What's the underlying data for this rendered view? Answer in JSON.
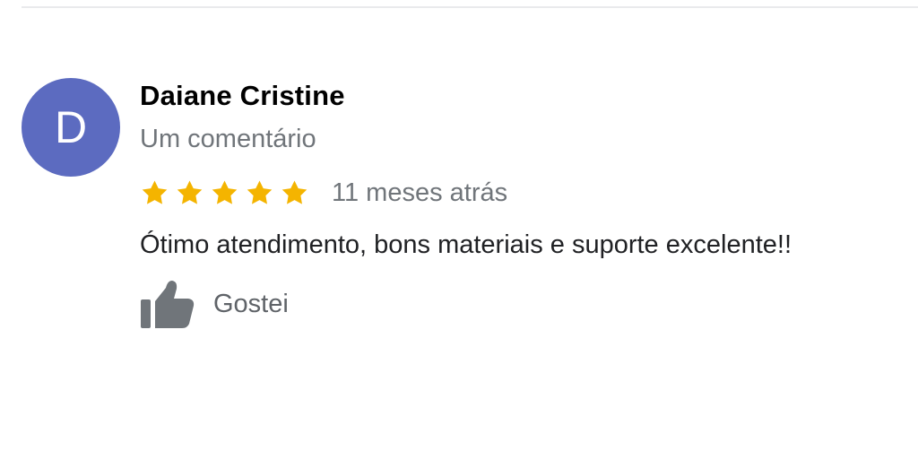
{
  "review": {
    "avatar_letter": "D",
    "avatar_color": "#5c6bc0",
    "reviewer_name": "Daiane Cristine",
    "review_count": "Um comentário",
    "rating": 5,
    "rating_max": 5,
    "star_icon": "star-icon",
    "star_color": "#f4b400",
    "time_ago": "11 meses atrás",
    "text": "Ótimo atendimento, bons materiais e suporte excelente!!",
    "like_icon": "thumbs-up-icon",
    "like_label": "Gostei"
  }
}
